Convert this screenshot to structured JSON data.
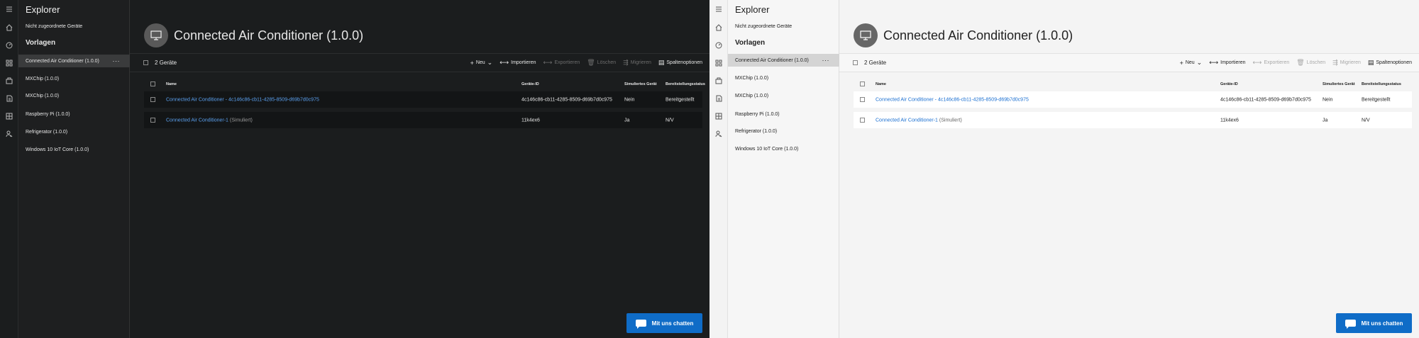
{
  "app_title": "Explorer",
  "nav": {
    "unassigned": "Nicht zugeordnete Geräte",
    "templates_header": "Vorlagen",
    "items": [
      {
        "label": "Connected Air Conditioner (1.0.0)",
        "more": "···"
      },
      {
        "label": "MXChip (1.0.0)"
      },
      {
        "label": "MXChip (1.0.0)"
      },
      {
        "label": "Raspberry Pi (1.0.0)"
      },
      {
        "label": "Refrigerator (1.0.0)"
      },
      {
        "label": "Windows 10 IoT Core (1.0.0)"
      }
    ]
  },
  "rail_icons": [
    "menu-icon",
    "home-icon",
    "dashboard-icon",
    "devices-icon",
    "device-groups-icon",
    "rules-icon",
    "apps-icon",
    "users-icon"
  ],
  "page": {
    "title": "Connected Air Conditioner (1.0.0)",
    "device_count": "2 Geräte"
  },
  "commands": [
    {
      "label": "Neu",
      "glyph": "+",
      "chevron": "⌄",
      "disabled": false
    },
    {
      "label": "Importieren",
      "glyph": "⟷",
      "disabled": false
    },
    {
      "label": "Exportieren",
      "glyph": "⟷",
      "disabled": true
    },
    {
      "label": "Löschen",
      "glyph": "🗑",
      "disabled": true
    },
    {
      "label": "Migrieren",
      "glyph": "⇶",
      "disabled": true
    },
    {
      "label": "Spaltenoptionen",
      "glyph": "▤",
      "disabled": false
    }
  ],
  "table": {
    "columns": [
      "Name",
      "Geräte-ID",
      "Simuliertes Gerät",
      "Bereitstellungsstatus"
    ],
    "rows": [
      {
        "name": "Connected Air Conditioner - 4c146c86-cb11-4285-8509-d69b7d0c975",
        "suffix": "",
        "id": "4c146c86-cb11-4285-8509-d69b7d0c975",
        "simulated": "Nein",
        "status": "Bereitgestellt"
      },
      {
        "name": "Connected Air Conditioner-1",
        "suffix": "(Simuliert)",
        "id": "11k4ex6",
        "simulated": "Ja",
        "status": "N/V"
      }
    ]
  },
  "chat_button": "Mit uns chatten",
  "colors": {
    "accent": "#0f6cc7",
    "dark_bg": "#1b1d1e",
    "light_bg": "#f3f3f3",
    "link_dark": "#5ba0ee",
    "link_light": "#1a6fd1"
  }
}
